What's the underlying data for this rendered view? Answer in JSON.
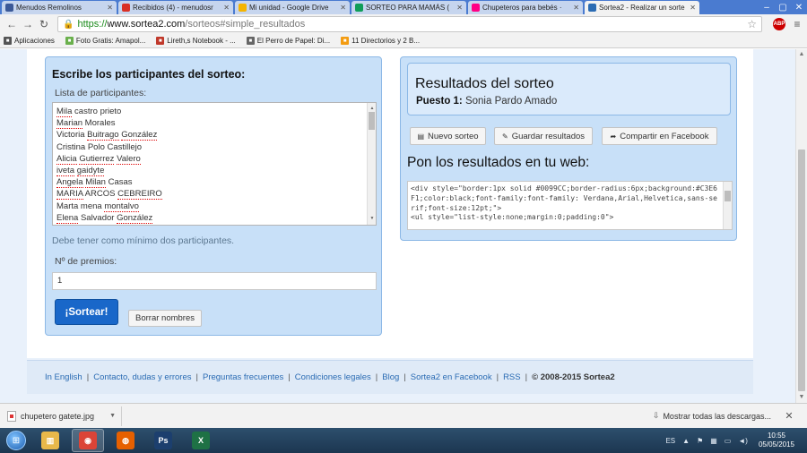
{
  "browser": {
    "tabs": [
      {
        "label": "Menudos Remolinos",
        "icon": "facebook-icon",
        "color": "#3b5998",
        "active": false
      },
      {
        "label": "Recibidos (4) - menudosr",
        "icon": "gmail-icon",
        "color": "#d93025",
        "active": false
      },
      {
        "label": "Mi unidad - Google Drive",
        "icon": "drive-icon",
        "color": "#f4b400",
        "active": false
      },
      {
        "label": "SORTEO PARA MAMÁS (",
        "icon": "sheets-icon",
        "color": "#0f9d58",
        "active": false
      },
      {
        "label": "Chupeteros para bebés ·",
        "icon": "flickr-icon",
        "color": "#ff0084",
        "active": false
      },
      {
        "label": "Sortea2 - Realizar un sorte",
        "icon": "sortea2-icon",
        "color": "#2a6bb3",
        "active": true
      }
    ],
    "url_scheme": "https://",
    "url_host": "www.sortea2.com",
    "url_path": "/sorteos#simple_resultados",
    "adblock_label": "ABP",
    "bookmarks": [
      {
        "label": "Aplicaciones",
        "icon": "apps-icon",
        "color": "#555555"
      },
      {
        "label": "Foto Gratis: Amapol...",
        "icon": "photo-icon",
        "color": "#6ab04c"
      },
      {
        "label": "Lireth,s Notebook - ...",
        "icon": "notebook-icon",
        "color": "#c0392b"
      },
      {
        "label": "El Perro de Papel: Di...",
        "icon": "dog-icon",
        "color": "#666666"
      },
      {
        "label": "11 Directorios y 2 B...",
        "icon": "blogger-icon",
        "color": "#f39c12"
      }
    ]
  },
  "left_panel": {
    "title": "Escribe los participantes del sorteo:",
    "list_label": "Lista de participantes:",
    "participants": [
      [
        {
          "t": "Mila",
          "s": true
        },
        {
          "t": " castro prieto",
          "s": false
        }
      ],
      [
        {
          "t": "Marian",
          "s": true
        },
        {
          "t": " Morales",
          "s": false
        }
      ],
      [
        {
          "t": "Victoria ",
          "s": false
        },
        {
          "t": "Buitrago",
          "s": true
        },
        {
          "t": " ",
          "s": false
        },
        {
          "t": "González",
          "s": true
        }
      ],
      [
        {
          "t": "Cristina Polo Castillejo",
          "s": false
        }
      ],
      [
        {
          "t": "Alicia",
          "s": true
        },
        {
          "t": " ",
          "s": false
        },
        {
          "t": "Gutierrez",
          "s": true
        },
        {
          "t": " ",
          "s": false
        },
        {
          "t": "Valero",
          "s": true
        }
      ],
      [
        {
          "t": "iveta",
          "s": true
        },
        {
          "t": " ",
          "s": false
        },
        {
          "t": "gaidyte",
          "s": true
        }
      ],
      [
        {
          "t": "Angela",
          "s": true
        },
        {
          "t": " ",
          "s": false
        },
        {
          "t": "Milan",
          "s": true
        },
        {
          "t": " Casas",
          "s": false
        }
      ],
      [
        {
          "t": "MARIA",
          "s": true
        },
        {
          "t": " ARCOS ",
          "s": false
        },
        {
          "t": "CEBREIRO",
          "s": true
        }
      ],
      [
        {
          "t": "Marta mena ",
          "s": false
        },
        {
          "t": "montalvo",
          "s": true
        }
      ],
      [
        {
          "t": "Elena",
          "s": true
        },
        {
          "t": " Salvador ",
          "s": false
        },
        {
          "t": "González",
          "s": true
        }
      ]
    ],
    "min_hint": "Debe tener como mínimo dos participantes.",
    "prizes_label": "Nº de premios:",
    "prizes_value": "1",
    "draw_button": "¡Sortear!",
    "clear_button": "Borrar nombres"
  },
  "right_panel": {
    "results_title": "Resultados del sorteo",
    "place_label": "Puesto 1:",
    "place_winner": "Sonia Pardo Amado",
    "new_draw_button": "Nuevo sorteo",
    "save_button": "Guardar resultados",
    "share_button": "Compartir en Facebook",
    "web_title": "Pon los resultados en tu web:",
    "embed_code": "<div style=\"border:1px solid #0099CC;border-radius:6px;background:#C3E6F1;color:black;font-family:font-family: Verdana,Arial,Helvetica,sans-serif;font-size:12pt;\">\n<ul style=\"list-style:none;margin:0;padding:0\">"
  },
  "footer": {
    "links": [
      "In English",
      "Contacto, dudas y errores",
      "Preguntas frecuentes",
      "Condiciones legales",
      "Blog",
      "Sortea2 en Facebook",
      "RSS"
    ],
    "copyright": "© 2008-2015 Sortea2"
  },
  "downloads": {
    "file": "chupetero gatete.jpg",
    "show_all": "Mostrar todas las descargas...",
    "close": "✕"
  },
  "taskbar": {
    "apps": [
      {
        "name": "explorer-icon",
        "color": "#e8b84a",
        "active": false
      },
      {
        "name": "chrome-icon",
        "color": "#db4437",
        "active": true
      },
      {
        "name": "firefox-icon",
        "color": "#e66000",
        "active": false
      },
      {
        "name": "photoshop-icon",
        "color": "#1c3f6e",
        "active": false
      },
      {
        "name": "excel-icon",
        "color": "#1e7145",
        "active": false
      }
    ],
    "lang": "ES",
    "time": "10:55",
    "date": "05/05/2015"
  }
}
